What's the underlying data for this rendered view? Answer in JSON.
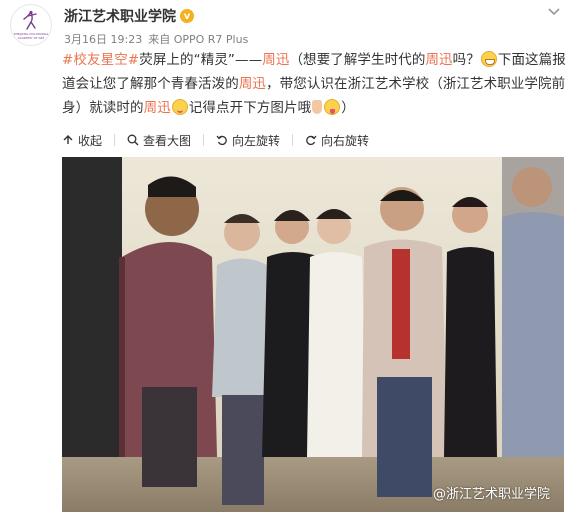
{
  "account": {
    "name": "浙江艺术职业学院",
    "verified_mark": "v",
    "logo_text_lines": [
      "ZHEJIANG VOCATIONAL",
      "ACADEMY OF ART"
    ]
  },
  "meta": {
    "date": "3月16日 19:23",
    "source": "来自 OPPO R7 Plus"
  },
  "post": {
    "segments": [
      {
        "type": "link",
        "text": "#校友星空#"
      },
      {
        "type": "text",
        "text": "荧屏上的“精灵”——"
      },
      {
        "type": "hl",
        "text": "周迅"
      },
      {
        "type": "text",
        "text": "（想要了解学生时代的"
      },
      {
        "type": "hl",
        "text": "周迅"
      },
      {
        "type": "text",
        "text": "吗？"
      },
      {
        "type": "emoji",
        "name": "grin-emoji"
      },
      {
        "type": "text",
        "text": "下面这篇报道会让您了解那个青春活泼的"
      },
      {
        "type": "hl",
        "text": "周迅"
      },
      {
        "type": "text",
        "text": "，带您认识在浙江艺术学校（浙江艺术职业学院前身）就读时的"
      },
      {
        "type": "hl",
        "text": "周迅"
      },
      {
        "type": "emoji",
        "name": "smile-emoji"
      },
      {
        "type": "text",
        "text": "记得点开下方图片哦"
      },
      {
        "type": "emoji",
        "name": "pointing-hand-emoji"
      },
      {
        "type": "emoji",
        "name": "tongue-emoji"
      },
      {
        "type": "text",
        "text": "）"
      }
    ]
  },
  "toolbar": {
    "collapse": "收起",
    "view_large": "查看大图",
    "rotate_left": "向左旋转",
    "rotate_right": "向右旋转"
  },
  "image": {
    "watermark": "@浙江艺术职业学院"
  },
  "colors": {
    "accent": "#eb7350",
    "verified": "#f6b01e",
    "text": "#333333",
    "meta": "#808080"
  }
}
